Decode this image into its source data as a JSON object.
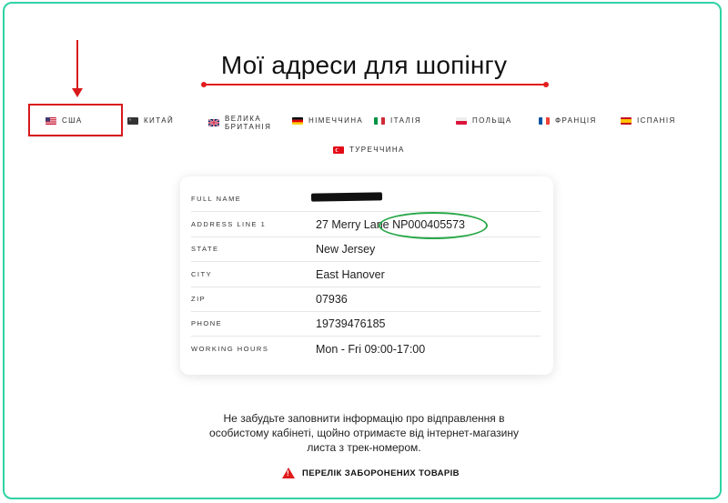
{
  "page": {
    "title": "Мої адреси для шопінгу",
    "accent_color": "#e21c1c",
    "frame_color": "#2fd3a4"
  },
  "tabs": [
    {
      "label": "США",
      "flag": "us-flag",
      "active": true
    },
    {
      "label": "КИТАЙ",
      "flag": "china-flag",
      "active": false
    },
    {
      "label_line1": "ВЕЛИКА",
      "label_line2": "БРИТАНІЯ",
      "flag": "uk-flag",
      "active": false
    },
    {
      "label": "НІМЕЧЧИНА",
      "flag": "germany-flag",
      "active": false
    },
    {
      "label": "ІТАЛІЯ",
      "flag": "italy-flag",
      "active": false
    },
    {
      "label": "ПОЛЬЩА",
      "flag": "poland-flag",
      "active": false
    },
    {
      "label": "ФРАНЦІЯ",
      "flag": "france-flag",
      "active": false
    },
    {
      "label": "ІСПАНІЯ",
      "flag": "spain-flag",
      "active": false
    },
    {
      "label": "ТУРЕЧЧИНА",
      "flag": "turkey-flag",
      "active": false
    }
  ],
  "address": [
    {
      "key": "FULL NAME",
      "value": ""
    },
    {
      "key": "ADDRESS LINE 1",
      "value": "27 Merry Lane NP000405573"
    },
    {
      "key": "STATE",
      "value": "New Jersey"
    },
    {
      "key": "CITY",
      "value": "East Hanover"
    },
    {
      "key": "ZIP",
      "value": "07936"
    },
    {
      "key": "PHONE",
      "value": "19739476185"
    },
    {
      "key": "WORKING HOURS",
      "value": "Mon - Fri 09:00-17:00"
    }
  ],
  "note": {
    "line1": "Не забудьте заповнити інформацію про відправлення в",
    "line2": "особистому кабінеті, щойно отримаєте від інтернет-магазину",
    "line3": "листа з трек-номером."
  },
  "prohibited_link": {
    "label": "ПЕРЕЛІК ЗАБОРОНЕНИХ ТОВАРІВ",
    "icon": "warning-icon"
  }
}
